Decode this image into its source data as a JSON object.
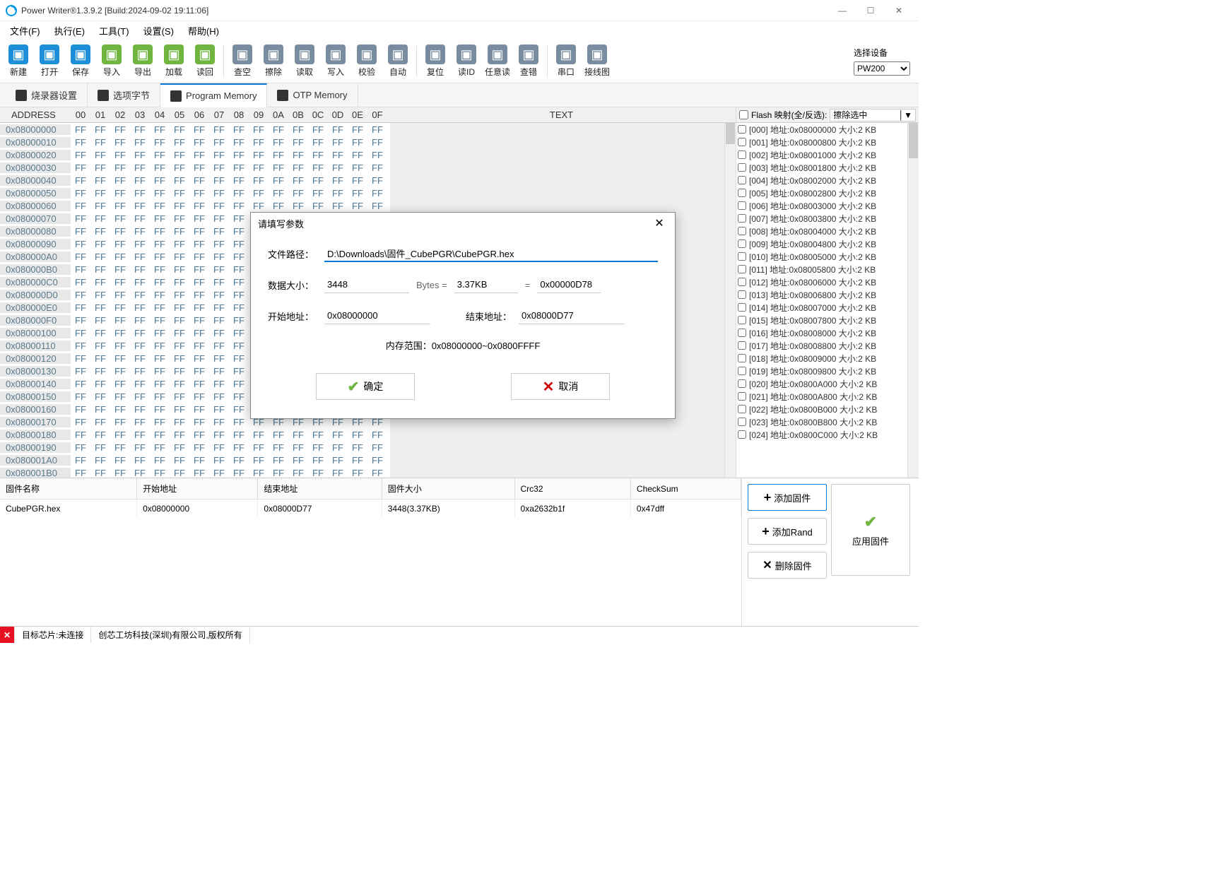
{
  "titlebar": {
    "title": "Power Writer®1.3.9.2 [Build:2024-09-02 19:11:06]"
  },
  "menu": [
    "文件(F)",
    "执行(E)",
    "工具(T)",
    "设置(S)",
    "帮助(H)"
  ],
  "toolbar": {
    "groups": [
      [
        {
          "l": "新建",
          "c": "#1d8fd8"
        },
        {
          "l": "打开",
          "c": "#1d8fd8"
        },
        {
          "l": "保存",
          "c": "#1d8fd8"
        },
        {
          "l": "导入",
          "c": "#6fb53f"
        },
        {
          "l": "导出",
          "c": "#6fb53f"
        },
        {
          "l": "加载",
          "c": "#6fb53f"
        },
        {
          "l": "读回",
          "c": "#6fb53f"
        }
      ],
      [
        {
          "l": "查空",
          "c": "#7a8ca0"
        },
        {
          "l": "擦除",
          "c": "#7a8ca0"
        },
        {
          "l": "读取",
          "c": "#7a8ca0"
        },
        {
          "l": "写入",
          "c": "#7a8ca0"
        },
        {
          "l": "校验",
          "c": "#7a8ca0"
        },
        {
          "l": "自动",
          "c": "#7a8ca0"
        }
      ],
      [
        {
          "l": "复位",
          "c": "#7a8ca0"
        },
        {
          "l": "读ID",
          "c": "#7a8ca0"
        },
        {
          "l": "任意读",
          "c": "#7a8ca0"
        },
        {
          "l": "查错",
          "c": "#7a8ca0"
        }
      ],
      [
        {
          "l": "串口",
          "c": "#7a8ca0"
        },
        {
          "l": "接线图",
          "c": "#7a8ca0"
        }
      ]
    ],
    "deviceLabel": "选择设备",
    "device": "PW200"
  },
  "tabs": [
    {
      "l": "烧录器设置"
    },
    {
      "l": "选项字节"
    },
    {
      "l": "Program Memory",
      "active": true
    },
    {
      "l": "OTP Memory"
    }
  ],
  "hex": {
    "addrHeader": "ADDRESS",
    "byteHeaders": [
      "00",
      "01",
      "02",
      "03",
      "04",
      "05",
      "06",
      "07",
      "08",
      "09",
      "0A",
      "0B",
      "0C",
      "0D",
      "0E",
      "0F"
    ],
    "textHeader": "TEXT",
    "baseAddr": "0x08000000",
    "rows": 28,
    "fill": "FF"
  },
  "flash": {
    "label": "Flash 映射(全/反选):",
    "combo": "擦除选中",
    "items": [
      "[000] 地址:0x08000000 大小:2 KB",
      "[001] 地址:0x08000800 大小:2 KB",
      "[002] 地址:0x08001000 大小:2 KB",
      "[003] 地址:0x08001800 大小:2 KB",
      "[004] 地址:0x08002000 大小:2 KB",
      "[005] 地址:0x08002800 大小:2 KB",
      "[006] 地址:0x08003000 大小:2 KB",
      "[007] 地址:0x08003800 大小:2 KB",
      "[008] 地址:0x08004000 大小:2 KB",
      "[009] 地址:0x08004800 大小:2 KB",
      "[010] 地址:0x08005000 大小:2 KB",
      "[011] 地址:0x08005800 大小:2 KB",
      "[012] 地址:0x08006000 大小:2 KB",
      "[013] 地址:0x08006800 大小:2 KB",
      "[014] 地址:0x08007000 大小:2 KB",
      "[015] 地址:0x08007800 大小:2 KB",
      "[016] 地址:0x08008000 大小:2 KB",
      "[017] 地址:0x08008800 大小:2 KB",
      "[018] 地址:0x08009000 大小:2 KB",
      "[019] 地址:0x08009800 大小:2 KB",
      "[020] 地址:0x0800A000 大小:2 KB",
      "[021] 地址:0x0800A800 大小:2 KB",
      "[022] 地址:0x0800B000 大小:2 KB",
      "[023] 地址:0x0800B800 大小:2 KB",
      "[024] 地址:0x0800C000 大小:2 KB"
    ]
  },
  "fwtable": {
    "headers": [
      "固件名称",
      "开始地址",
      "结束地址",
      "固件大小",
      "Crc32",
      "CheckSum"
    ],
    "row": [
      "CubePGR.hex",
      "0x08000000",
      "0x08000D77",
      "3448(3.37KB)",
      "0xa2632b1f",
      "0x47dff"
    ]
  },
  "fwbuttons": {
    "add": "添加固件",
    "rand": "添加Rand",
    "del": "删除固件",
    "apply": "应用固件"
  },
  "status": {
    "chip": "目标芯片:未连接",
    "company": "创芯工坊科技(深圳)有限公司,版权所有"
  },
  "dialog": {
    "title": "请填写参数",
    "pathLabel": "文件路径：",
    "path": "D:\\Downloads\\固件_CubePGR\\CubePGR.hex",
    "sizeLabel": "数据大小：",
    "sizeBytes": "3448",
    "bytesEq": "Bytes =",
    "sizeKB": "3.37KB",
    "eq": "=",
    "sizeHex": "0x00000D78",
    "startLabel": "开始地址：",
    "startAddr": "0x08000000",
    "endLabel": "结束地址：",
    "endAddr": "0x08000D77",
    "range": "内存范围：0x08000000~0x0800FFFF",
    "ok": "确定",
    "cancel": "取消"
  }
}
